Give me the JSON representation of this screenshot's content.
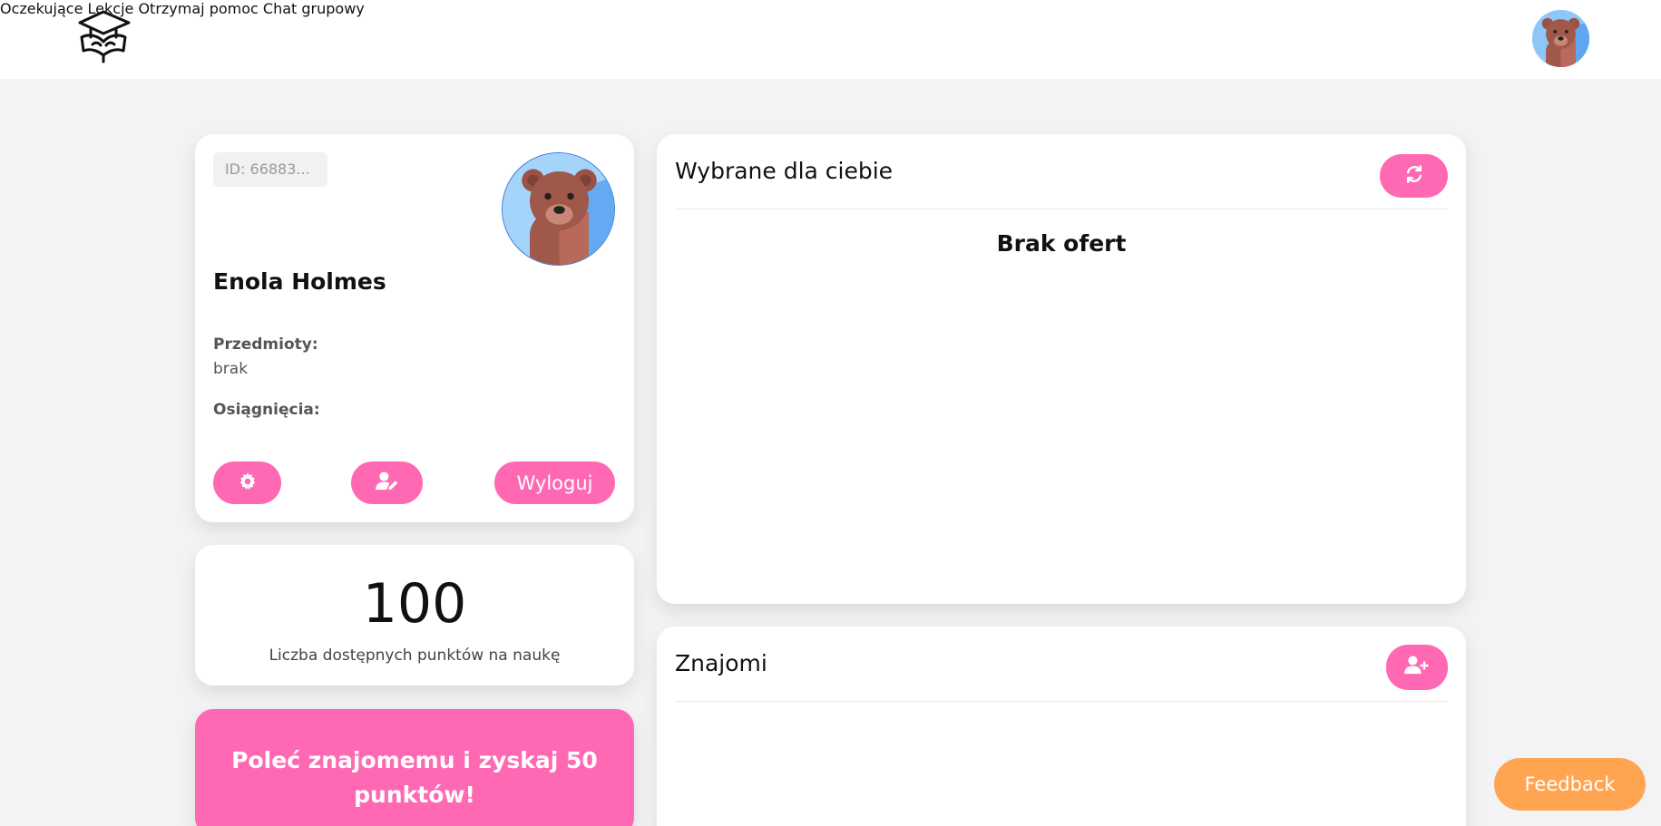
{
  "nav": {
    "pending": "Oczekujące",
    "lessons": "Lekcje",
    "get_help": "Otrzymaj pomoc",
    "group_chat": "Chat grupowy"
  },
  "profile": {
    "id": "ID: 66883...",
    "name": "Enola Holmes",
    "subjects_label": "Przedmioty:",
    "subjects_value": "brak",
    "achievements_label": "Osiągnięcia:",
    "logout_label": "Wyloguj"
  },
  "points": {
    "value": "100",
    "label": "Liczba dostępnych punktów na naukę"
  },
  "referral": {
    "text": "Poleć znajomemu i zyskaj 50 punktów!"
  },
  "offers": {
    "title": "Wybrane dla ciebie",
    "empty_text": "Brak ofert"
  },
  "friends": {
    "title": "Znajomi"
  },
  "feedback": {
    "label": "Feedback"
  },
  "colors": {
    "accent_pink": "#ff69b4",
    "feedback_orange": "#ffa552",
    "background": "#f3f3f5",
    "avatar_bear": "#a2574a"
  },
  "icons": {
    "logo": "graduation-cap-book-logo-icon",
    "settings": "gear-icon",
    "edit_profile": "user-edit-icon",
    "refresh": "refresh-icon",
    "add_friend": "user-plus-icon",
    "avatar": "bear-avatar-icon"
  }
}
